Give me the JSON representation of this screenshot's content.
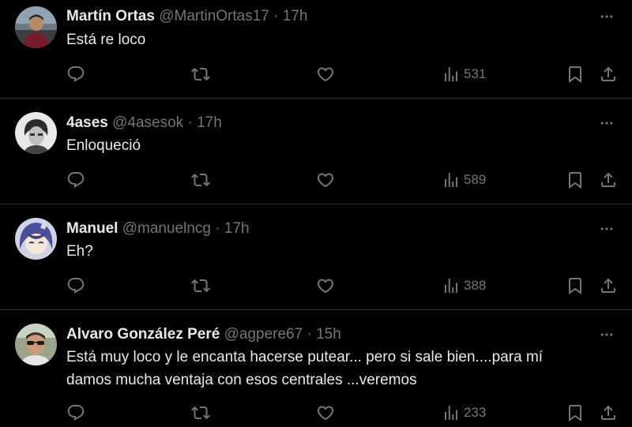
{
  "tweets": [
    {
      "name": "Martín Ortas",
      "handle": "@MartinOrtas17",
      "separator": "·",
      "time": "17h",
      "text": "Está re loco",
      "views": "531",
      "avatar": "avatar-photo-man-outdoors"
    },
    {
      "name": "4ases",
      "handle": "@4asesok",
      "separator": "·",
      "time": "17h",
      "text": "Enloqueció",
      "views": "589",
      "avatar": "avatar-black-white-portrait"
    },
    {
      "name": "Manuel",
      "handle": "@manuelncg",
      "separator": "·",
      "time": "17h",
      "text": "Eh?",
      "views": "388",
      "avatar": "avatar-anime-character"
    },
    {
      "name": "Alvaro González Peré",
      "handle": "@agpere67",
      "separator": "·",
      "time": "15h",
      "text_lines": [
        "Está muy loco y le encanta hacerse putear... pero si sale bien....para mí",
        "damos mucha ventaja con esos centrales ...veremos"
      ],
      "views": "233",
      "avatar": "avatar-photo-man-sunglasses"
    }
  ],
  "icons": {
    "more": "more-horizontal-icon",
    "reply": "reply-icon",
    "repost": "repost-icon",
    "like": "heart-icon",
    "views": "views-chart-icon",
    "bookmark": "bookmark-icon",
    "share": "share-icon"
  },
  "colors": {
    "background": "#000000",
    "text": "#e7e9ea",
    "secondary": "#71767b",
    "divider": "#2f3336"
  }
}
